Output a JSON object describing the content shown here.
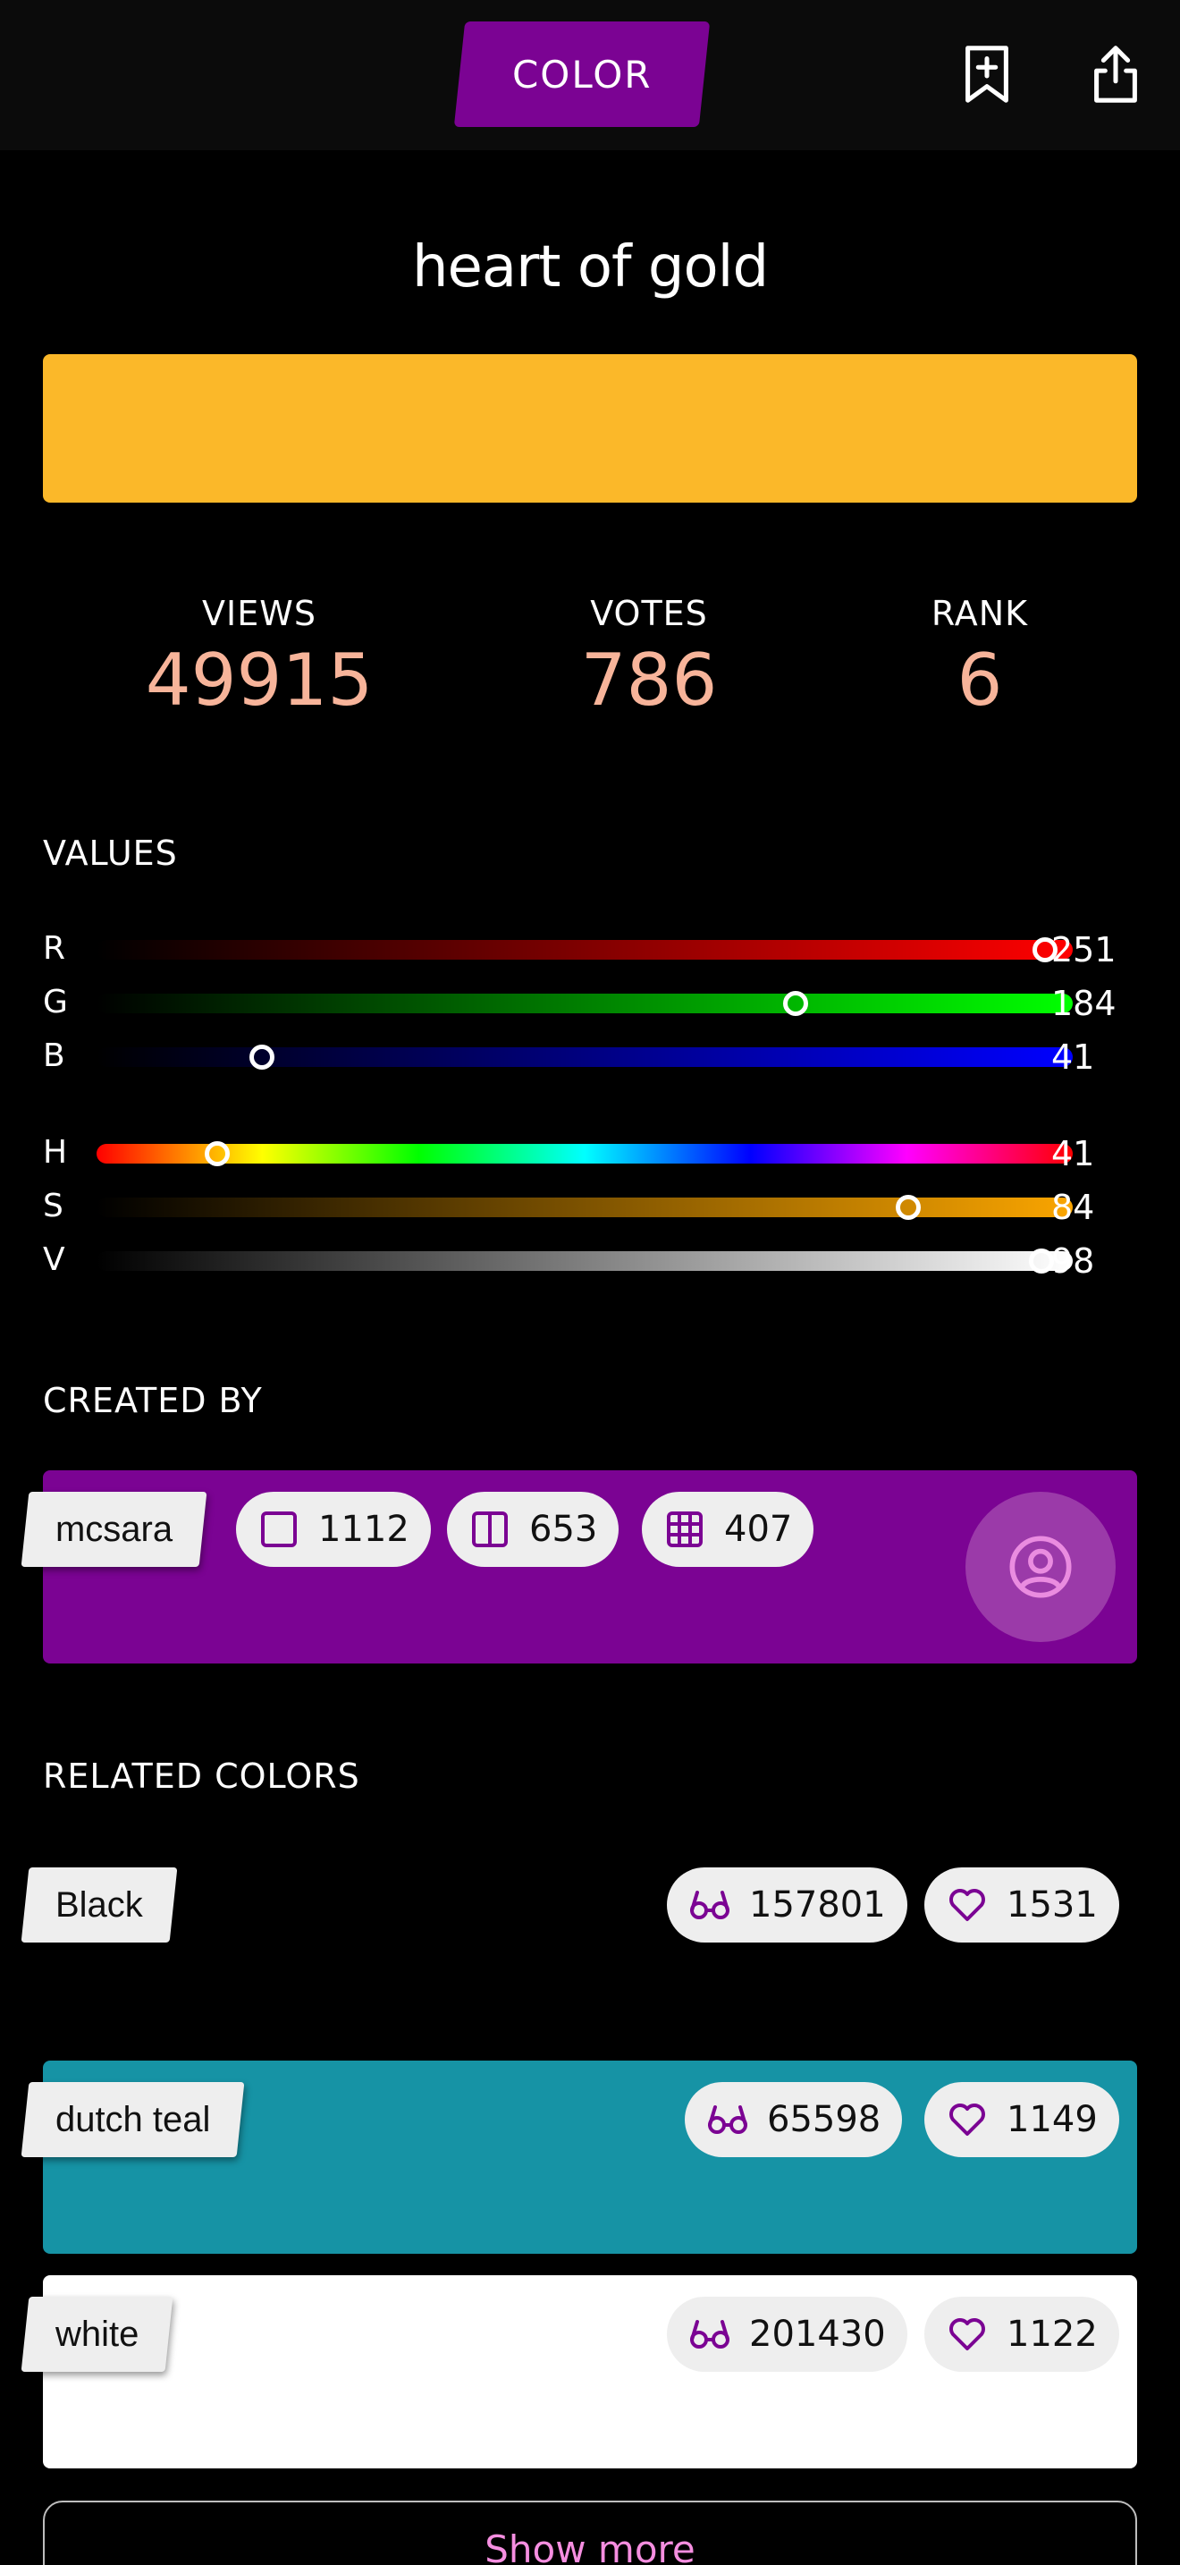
{
  "header": {
    "tab_label": "COLOR",
    "icons": [
      "bookmark-add-icon",
      "share-icon"
    ]
  },
  "color": {
    "name": "heart of gold",
    "hex": "#FBB829"
  },
  "stats": {
    "views_label": "VIEWS",
    "views": "49915",
    "votes_label": "VOTES",
    "votes": "786",
    "rank_label": "RANK",
    "rank": "6"
  },
  "values": {
    "title": "VALUES",
    "rgb": [
      {
        "letter": "R",
        "value": "251",
        "fraction": 0.984
      },
      {
        "letter": "G",
        "value": "184",
        "fraction": 0.722
      },
      {
        "letter": "B",
        "value": "41",
        "fraction": 0.161
      }
    ],
    "hsv": [
      {
        "letter": "H",
        "value": "41",
        "fraction": 0.114
      },
      {
        "letter": "S",
        "value": "84",
        "fraction": 0.84
      },
      {
        "letter": "V",
        "value": "98",
        "fraction": 0.98
      }
    ]
  },
  "created_by": {
    "title": "CREATED BY",
    "username": "mcsara",
    "colors_count": "1112",
    "palettes_count": "653",
    "patterns_count": "407",
    "card_color": "#7B0393"
  },
  "related": {
    "title": "RELATED COLORS",
    "items": [
      {
        "name": "Black",
        "views": "157801",
        "hearts": "1531",
        "color": "#000000"
      },
      {
        "name": "dutch teal",
        "views": "65598",
        "hearts": "1149",
        "color": "#1693A5"
      },
      {
        "name": "white",
        "views": "201430",
        "hearts": "1122",
        "color": "#FFFFFF"
      }
    ],
    "show_more_label": "Show more"
  },
  "accent": {
    "purple": "#7B0393",
    "stat_number": "#F7B49A",
    "show_more_text": "#F58EE0"
  }
}
